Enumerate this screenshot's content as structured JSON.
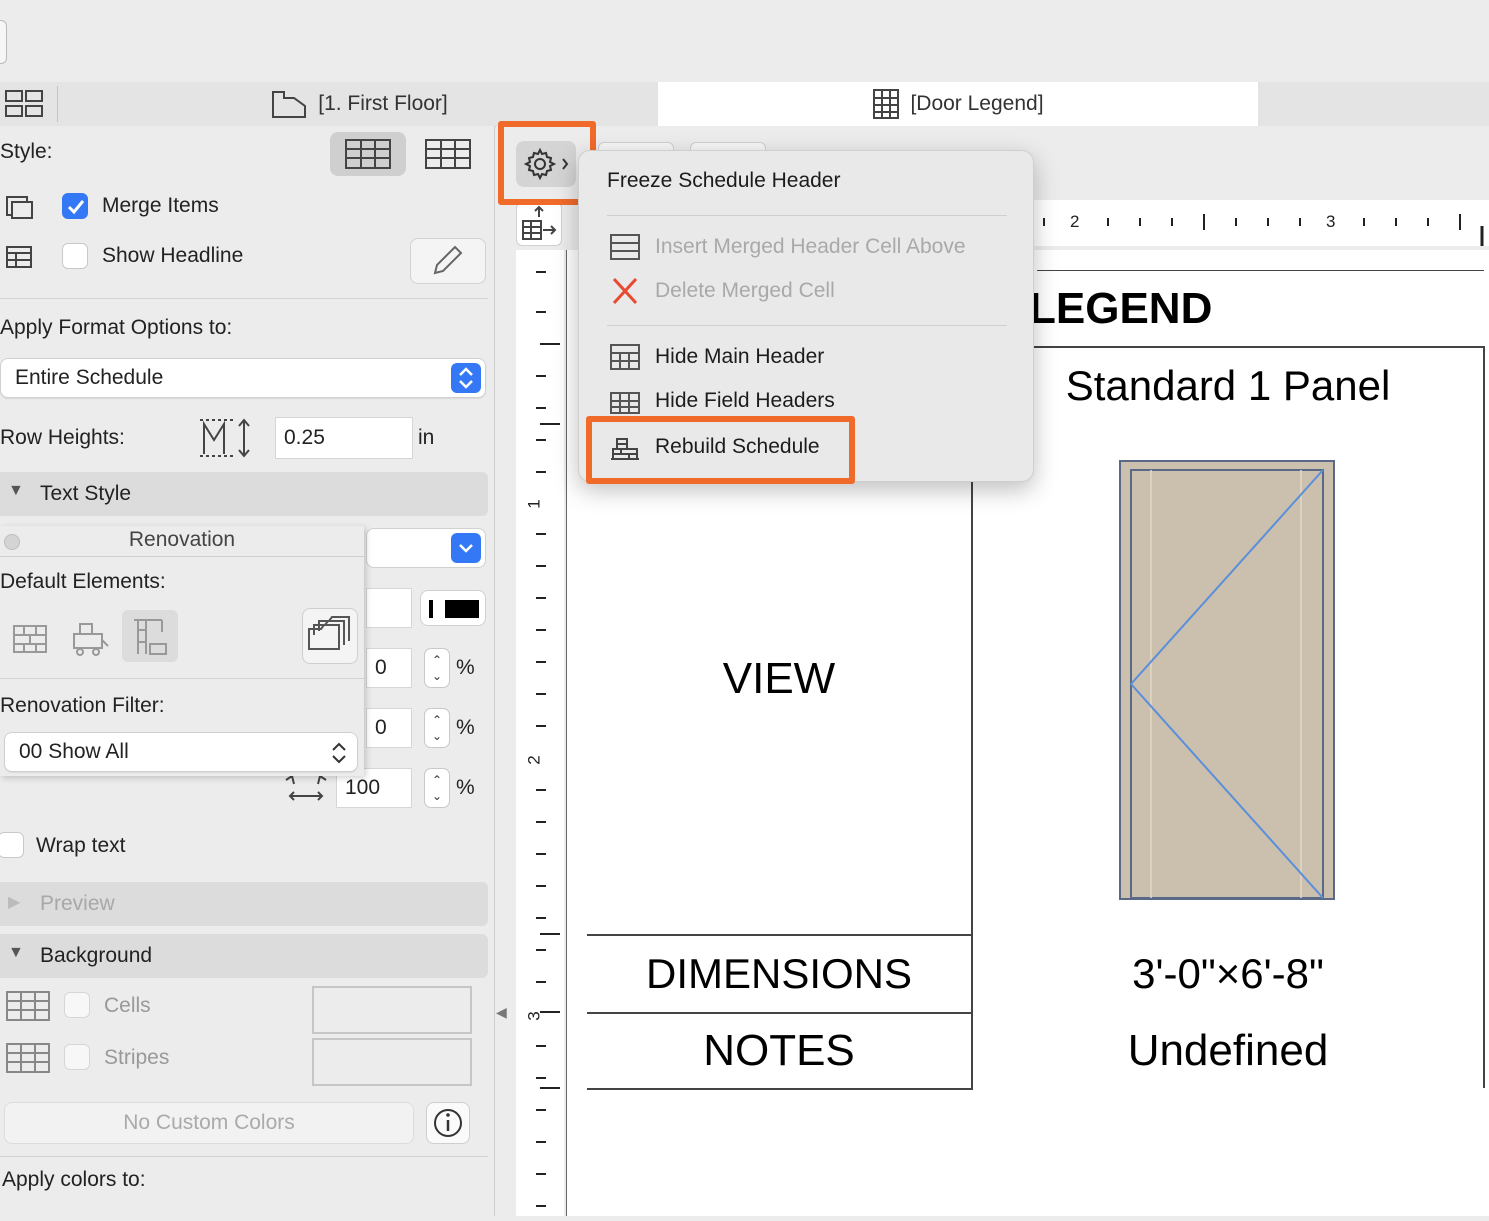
{
  "tabs": [
    {
      "label": "[1. First Floor]"
    },
    {
      "label": "[Door Legend]"
    }
  ],
  "left_panel": {
    "style_label": "Style:",
    "merge_items": {
      "label": "Merge Items",
      "checked": true
    },
    "show_headline": {
      "label": "Show Headline",
      "checked": false
    },
    "apply_format_label": "Apply Format Options to:",
    "apply_format_value": "Entire Schedule",
    "row_heights_label": "Row Heights:",
    "row_heights_value": "0.25",
    "row_heights_unit": "in",
    "text_style_label": "Text Style",
    "percent_values": [
      "0",
      "0",
      "100"
    ],
    "percent_unit": "%",
    "wrap_text_label": "Wrap text",
    "preview_label": "Preview",
    "background_label": "Background",
    "cells_label": "Cells",
    "stripes_label": "Stripes",
    "no_custom_colors_label": "No Custom Colors",
    "apply_colors_label": "Apply colors to:"
  },
  "renovation_popup": {
    "title": "Renovation",
    "default_elements_label": "Default Elements:",
    "filter_label": "Renovation Filter:",
    "filter_value": "00 Show All"
  },
  "context_menu": {
    "items": [
      {
        "label": "Freeze Schedule Header",
        "enabled": true
      },
      {
        "label": "Insert Merged Header Cell Above",
        "enabled": false
      },
      {
        "label": "Delete Merged Cell",
        "enabled": false
      },
      {
        "label": "Hide Main Header",
        "enabled": true
      },
      {
        "label": "Hide Field Headers",
        "enabled": true
      },
      {
        "label": "Rebuild Schedule",
        "enabled": true
      }
    ],
    "highlight_color": "#f06a2a"
  },
  "ruler": {
    "h_labels": [
      "2",
      "3"
    ],
    "v_labels": [
      "1",
      "2",
      "3"
    ]
  },
  "schedule": {
    "title_fragment": "LEGEND",
    "panel_title": "Standard 1 Panel",
    "row_labels": [
      "VIEW",
      "DIMENSIONS",
      "NOTES"
    ],
    "dimensions_value": "3'-0\"×6'-8\"",
    "notes_value": "Undefined",
    "door_fill_color": "#cbbfae",
    "door_line_color": "#5b8fd9"
  }
}
